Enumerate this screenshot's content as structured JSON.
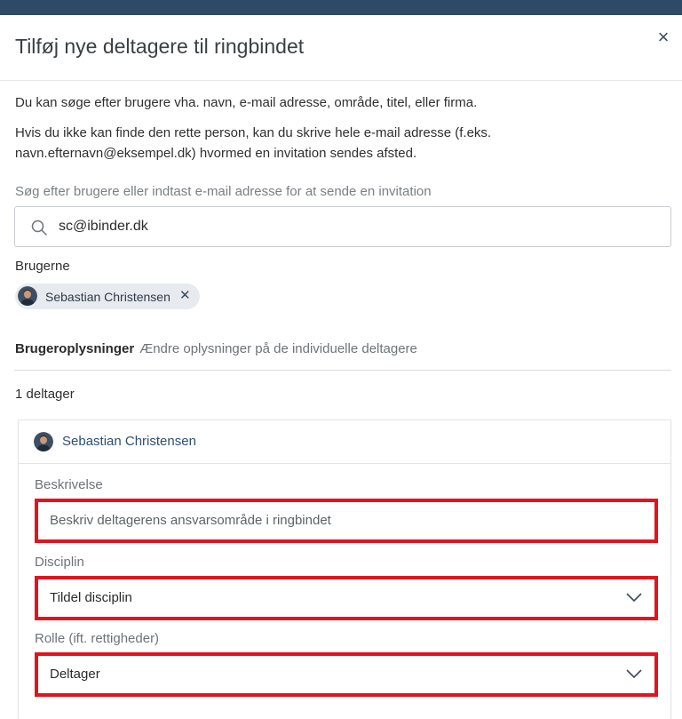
{
  "modal": {
    "title": "Tilføj nye deltagere til ringbindet",
    "close_label": "×"
  },
  "intro": {
    "line1": "Du kan søge efter brugere vha. navn, e-mail adresse, område, titel, eller firma.",
    "line2": "Hvis du ikke kan finde den rette person, kan du skrive hele e-mail adresse (f.eks. navn.efternavn@eksempel.dk) hvormed en invitation sendes afsted."
  },
  "search": {
    "label": "Søg efter brugere eller indtast e-mail adresse for at sende en invitation",
    "value": "sc@ibinder.dk",
    "icon": "search-icon"
  },
  "users": {
    "label": "Brugerne",
    "chips": [
      {
        "name": "Sebastian Christensen",
        "remove_label": "✕"
      }
    ]
  },
  "user_info": {
    "title": "Brugeroplysninger",
    "subtitle": "Ændre oplysninger på de individuelle deltagere"
  },
  "participants": {
    "count_label": "1 deltager",
    "items": [
      {
        "name": "Sebastian Christensen",
        "description": {
          "label": "Beskrivelse",
          "placeholder": "Beskriv deltagerens ansvarsområde i ringbindet"
        },
        "discipline": {
          "label": "Disciplin",
          "selected": "Tildel disciplin"
        },
        "role": {
          "label": "Rolle (ift. rettigheder)",
          "selected": "Deltager"
        }
      }
    ]
  },
  "colors": {
    "topbar": "#2f4a66",
    "highlight": "#e3131d",
    "link": "#2d4f74",
    "chip_bg": "#e7ebf0"
  }
}
